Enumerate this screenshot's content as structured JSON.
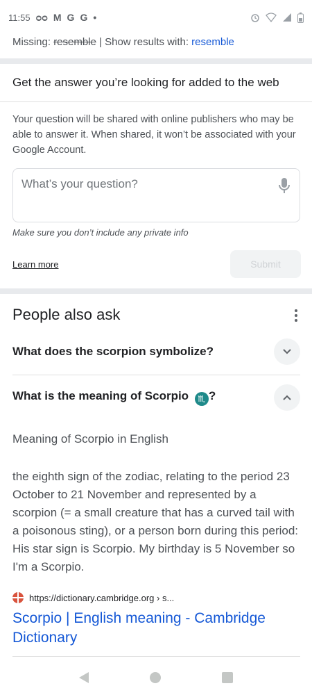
{
  "status_bar": {
    "time": "11:55",
    "left_glyphs": [
      "ᴑᴑ",
      "M",
      "G",
      "G",
      "•"
    ]
  },
  "missing": {
    "prefix": "Missing: ",
    "strike": "resemble",
    "separator": " | Show results with: ",
    "link": "resemble"
  },
  "ask": {
    "title": "Get the answer you’re looking for added to the web",
    "description": "Your question will be shared with online publishers who may be able to answer it. When shared, it won’t be associated with your Google Account.",
    "placeholder": "What’s your question?",
    "private_note": "Make sure you don’t include any private info",
    "learn_more": "Learn more",
    "submit": "Submit"
  },
  "paa": {
    "title": "People also ask",
    "questions": [
      {
        "text": "What does the scorpion symbolize?",
        "expanded": false
      },
      {
        "text": "What is the meaning of Scorpio",
        "emoji": "♏",
        "suffix": "?",
        "expanded": true
      }
    ],
    "answer_heading": "Meaning of Scorpio in English",
    "answer_body": "the eighth sign of the zodiac, relating to the period 23 October to 21 November and represented by a scorpion (= a small creature that has a curved tail with a poisonous sting), or a person born during this period: His star sign is Scorpio. My birthday is 5 November so I'm a Scorpio.",
    "source_url": "https://dictionary.cambridge.org › s...",
    "source_title": "Scorpio | English meaning - Cambridge Dictionary"
  },
  "colors": {
    "link": "#1558d6",
    "divider": "#e8eaed",
    "zodiac_badge": "#1f8a8a",
    "favicon": "#d9533d"
  },
  "icons": [
    "mic-icon",
    "kebab-menu-icon",
    "chevron-down-icon",
    "chevron-up-icon",
    "favicon-icon",
    "back-icon",
    "home-icon",
    "recents-icon",
    "alarm-icon",
    "wifi-icon",
    "signal-icon",
    "battery-icon"
  ]
}
